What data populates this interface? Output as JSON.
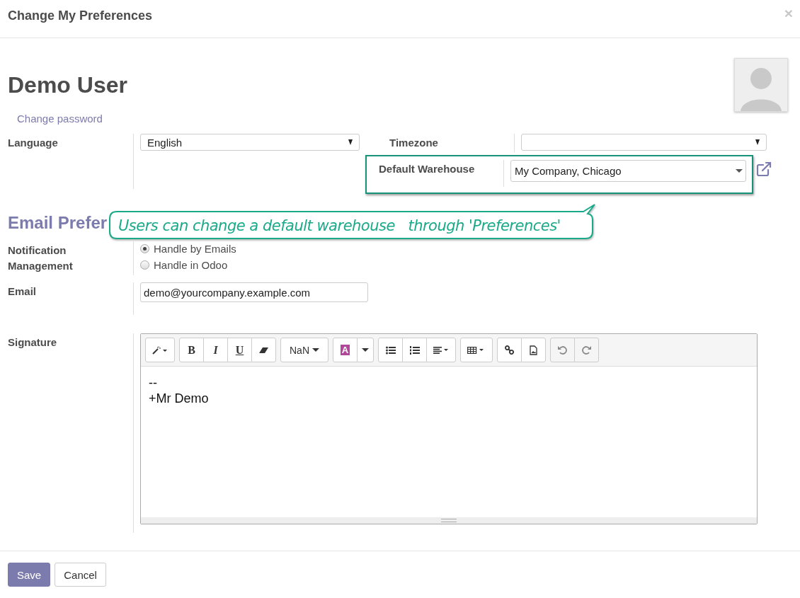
{
  "dialog": {
    "title": "Change My Preferences",
    "close": "×"
  },
  "user": {
    "name": "Demo User",
    "change_password": "Change password"
  },
  "language": {
    "label": "Language",
    "value": "English"
  },
  "timezone": {
    "label": "Timezone"
  },
  "warehouse": {
    "label": "Default Warehouse",
    "value": "My Company, Chicago",
    "highlighted": true
  },
  "callout": "Users can change a default warehouse   through 'Preferences'",
  "section_title": "Email Prefer",
  "notification": {
    "label": "Notification Management",
    "options": [
      {
        "label": "Handle by Emails",
        "selected": true
      },
      {
        "label": "Handle in Odoo",
        "selected": false
      }
    ]
  },
  "email": {
    "label": "Email",
    "value": "demo@yourcompany.example.com"
  },
  "signature": {
    "label": "Signature",
    "toolbar": {
      "bold": "B",
      "italic": "I",
      "underline": "U",
      "font_size": "NaN",
      "font_color": "A"
    },
    "lines": [
      "--",
      "+Mr Demo"
    ]
  },
  "buttons": [
    {
      "label": "Save",
      "kind": "primary"
    },
    {
      "label": "Cancel",
      "kind": "secondary"
    }
  ]
}
